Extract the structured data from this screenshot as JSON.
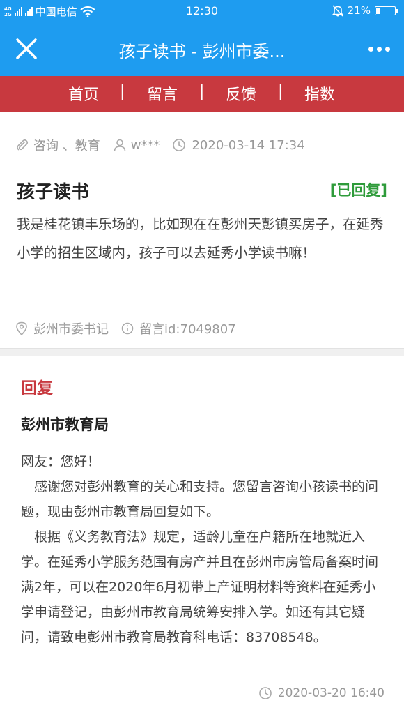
{
  "status_bar": {
    "network_top": "4G",
    "network_bottom": "2G",
    "carrier": "中国电信",
    "time": "12:30",
    "battery_text": "21%",
    "battery_level": 0.21
  },
  "header": {
    "title": "孩子读书 - 彭州市委...",
    "colors": {
      "background": "#1e9cf0",
      "text": "#ffffff"
    }
  },
  "nav": {
    "background": "#c8393f",
    "separator": "|",
    "items": [
      {
        "label": "首页"
      },
      {
        "label": "留言"
      },
      {
        "label": "反馈"
      },
      {
        "label": "指数"
      }
    ]
  },
  "question": {
    "category": "咨询 、教育",
    "user": "w***",
    "date": "2020-03-14 17:34",
    "title": "孩子读书",
    "status": "[已回复]",
    "status_color": "#2e9b3a",
    "body": "我是桂花镇丰乐场的，比如现在在彭州天彭镇买房子，在延秀小学的招生区域内，孩子可以去延秀小学读书嘛！",
    "recipient": "彭州市委书记",
    "message_id": "留言id:7049807"
  },
  "reply": {
    "label": "回复",
    "label_color": "#c8393f",
    "org": "彭州市教育局",
    "paragraphs": [
      "网友：您好！",
      "　感谢您对彭州教育的关心和支持。您留言咨询小孩读书的问题，现由彭州市教育局回复如下。",
      "　根据《义务教育法》规定，适龄儿童在户籍所在地就近入学。在延秀小学服务范围有房产并且在彭州市房管局备案时间满2年，可以在2020年6月初带上产证明材料等资料在延秀小学申请登记，由彭州市教育局统筹安排入学。如还有其它疑问，请致电彭州市教育局教育科电话：83708548。"
    ],
    "time": "2020-03-20 16:40"
  }
}
